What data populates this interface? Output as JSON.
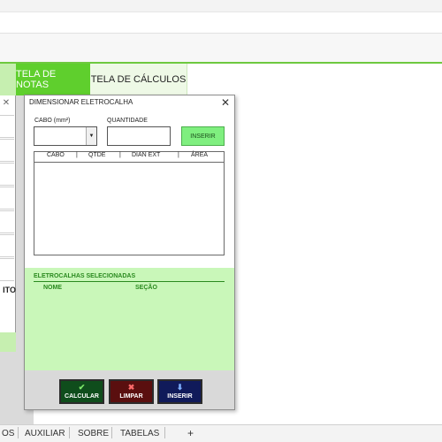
{
  "tabs": [
    {
      "label": "TELA DE NOTAS"
    },
    {
      "label": "TELA DE CÁLCULOS"
    }
  ],
  "left_dialog": {
    "close_glyph": "✕",
    "truncated_text": "ITO"
  },
  "dialog": {
    "title": "DIMENSIONAR ELETROCALHA",
    "close_glyph": "✕",
    "cabo_label": "CABO (mm²)",
    "quantidade_label": "QUANTIDADE",
    "combo_arrow": "▼",
    "insert_small_label": "INSERIR",
    "list_columns": [
      "CABO",
      "QTDE",
      "DIAN EXT",
      "ÁREA"
    ],
    "selected_title": "ELETROCALHAS SELECIONADAS",
    "selected_columns": [
      "NOME",
      "SEÇÃO"
    ],
    "buttons": {
      "calcular": {
        "label": "CALCULAR",
        "icon": "checkmark-icon",
        "glyph": "✔"
      },
      "limpar": {
        "label": "LIMPAR",
        "icon": "x-icon",
        "glyph": "✖"
      },
      "inserir": {
        "label": "INSERIR",
        "icon": "down-arrow-icon",
        "glyph": "⬇"
      }
    }
  },
  "sheet_tabs": [
    "OS",
    "AUXILIAR",
    "SOBRE",
    "TABELAS"
  ],
  "add_sheet_glyph": "+",
  "colors": {
    "active_tab": "#5fcf2d",
    "green_panel": "#c9f7b9",
    "insert_button": "#7fef7f",
    "calcular_button": "#0f4d1c",
    "limpar_button": "#5a0f0f",
    "inserir_button": "#101a5a"
  }
}
